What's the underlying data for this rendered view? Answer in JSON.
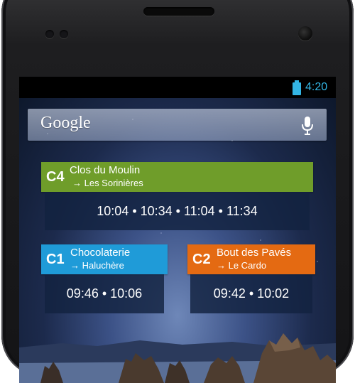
{
  "status_bar": {
    "time": "4:20",
    "battery_icon": "battery-full-icon",
    "accent": "#33b5e5"
  },
  "search": {
    "logo": "Google",
    "mic_icon": "microphone-icon"
  },
  "widgets": [
    {
      "line": "C4",
      "stop": "Clos du Moulin",
      "direction": "→ Les Sorinières",
      "times": "10:04 • 10:34 • 11:04 • 11:34",
      "color": "#6f9d2a"
    },
    {
      "line": "C1",
      "stop": "Chocolaterie",
      "direction": "→ Haluchère",
      "times": "09:46 • 10:06",
      "color": "#1f9bd8"
    },
    {
      "line": "C2",
      "stop": "Bout des Pavés",
      "direction": "→ Le Cardo",
      "times": "09:42 • 10:02",
      "color": "#e46a12"
    }
  ]
}
